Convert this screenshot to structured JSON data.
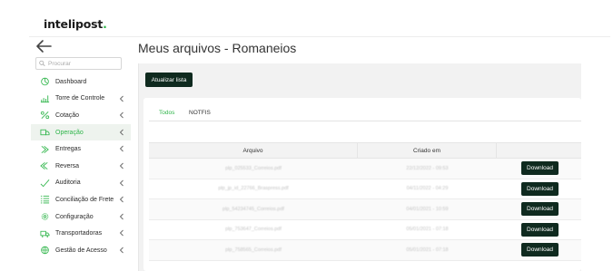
{
  "brand": {
    "name": "intelipost",
    "dot": "."
  },
  "sidebar": {
    "search_placeholder": "Procurar",
    "items": [
      {
        "label": "Dashboard",
        "icon": "dashboard-icon",
        "chevron": false,
        "active": false
      },
      {
        "label": "Torre de Controle",
        "icon": "bar-chart-icon",
        "chevron": true,
        "active": false
      },
      {
        "label": "Cotação",
        "icon": "percent-icon",
        "chevron": true,
        "active": false
      },
      {
        "label": "Operação",
        "icon": "truck-box-icon",
        "chevron": true,
        "active": true
      },
      {
        "label": "Entregas",
        "icon": "arrow-right-icon",
        "chevron": true,
        "active": false
      },
      {
        "label": "Reversa",
        "icon": "return-icon",
        "chevron": true,
        "active": false
      },
      {
        "label": "Auditoria",
        "icon": "check-icon",
        "chevron": true,
        "active": false
      },
      {
        "label": "Conciliação de Frete",
        "icon": "list-icon",
        "chevron": true,
        "active": false
      },
      {
        "label": "Configuração",
        "icon": "gear-icon",
        "chevron": true,
        "active": false
      },
      {
        "label": "Transportadoras",
        "icon": "truck-icon",
        "chevron": true,
        "active": false
      },
      {
        "label": "Gestão de Acesso",
        "icon": "globe-icon",
        "chevron": true,
        "active": false
      }
    ]
  },
  "main": {
    "title": "Meus arquivos - Romaneios",
    "refresh_label": "Atualizar lista",
    "tabs": [
      {
        "label": "Todos",
        "active": true
      },
      {
        "label": "NOTFIS",
        "active": false
      }
    ],
    "table": {
      "columns": [
        "Arquivo",
        "Criado em",
        ""
      ],
      "rows": [
        {
          "file": "plp_025533_Correios.pdf",
          "created": "22/12/2022 - 09:53",
          "action": "Download"
        },
        {
          "file": "plp_jp_id_22766_Braspress.pdf",
          "created": "04/11/2022 - 04:29",
          "action": "Download"
        },
        {
          "file": "plp_54234745_Correios.pdf",
          "created": "04/01/2021 - 10:59",
          "action": "Download"
        },
        {
          "file": "plp_753647_Correios.pdf",
          "created": "05/01/2021 - 07:18",
          "action": "Download"
        },
        {
          "file": "plp_758565_Correios.pdf",
          "created": "05/01/2021 - 07:18",
          "action": "Download"
        }
      ]
    }
  },
  "colors": {
    "accent": "#2fb54a",
    "button_dark": "#0f2a1f"
  }
}
